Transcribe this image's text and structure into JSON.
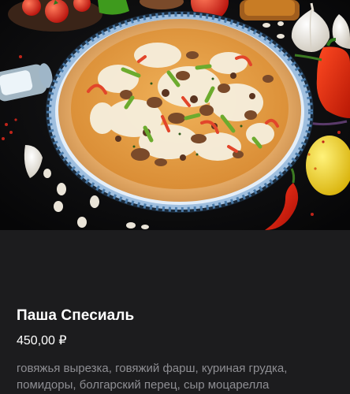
{
  "product": {
    "image_alt": "Паша Спесиаль",
    "name": "Паша Спесиаль",
    "price": "450,00 ₽",
    "description": "говяжья вырезка, говяжий фарш, куриная грудка, помидоры, болгарский перец, сыр моцарелла"
  },
  "colors": {
    "background": "#1c1c1e",
    "hero_background": "#0c0c0e",
    "title": "#ffffff",
    "price": "#ffffff",
    "description": "#8e8e93",
    "plate_rim": "#8fb3d6",
    "pizza_crust": "#d9a05b",
    "sauce": "#e8a648",
    "cheese": "#f4ecd8",
    "pepper_green": "#6cab2e",
    "pepper_red": "#e2452a"
  }
}
